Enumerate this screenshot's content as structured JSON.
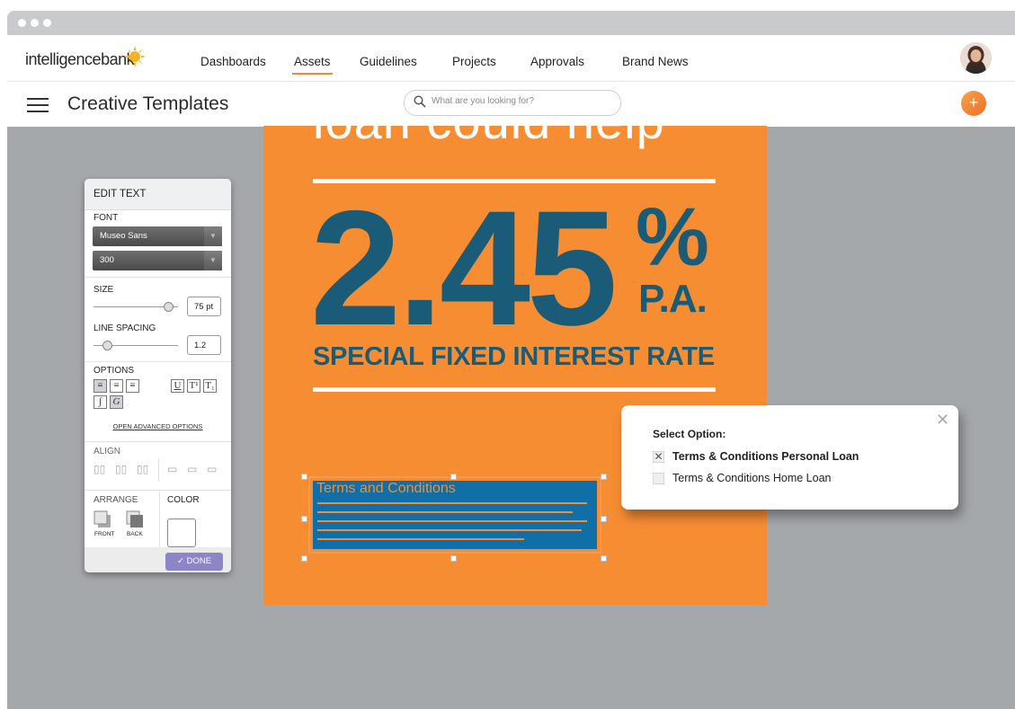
{
  "brand": {
    "name_light": "intelligence",
    "name_bold": "bank",
    "accent": "#f58a35"
  },
  "nav": {
    "items": [
      {
        "label": "Dashboards"
      },
      {
        "label": "Assets",
        "active": true
      },
      {
        "label": "Guidelines"
      },
      {
        "label": "Projects"
      },
      {
        "label": "Approvals"
      },
      {
        "label": "Brand News"
      }
    ]
  },
  "subheader": {
    "title": "Creative Templates",
    "search_placeholder": "What are you looking for?",
    "add_icon": "plus-icon"
  },
  "artwork": {
    "headline": "loan could help",
    "rate": "2.45",
    "percent": "%",
    "pa": "P.A.",
    "subline": "SPECIAL FIXED INTEREST RATE",
    "terms_label": "Terms and Conditions",
    "background": "#f68d33",
    "text_color": "#1a5c77"
  },
  "edit_panel": {
    "title": "EDIT TEXT",
    "font_label": "FONT",
    "font_family": "Museo Sans",
    "font_weight": "300",
    "size_label": "SIZE",
    "size_value": "75 pt",
    "line_spacing_label": "LINE SPACING",
    "line_spacing_value": "1.2",
    "options_label": "OPTIONS",
    "advanced_link": "OPEN ADVANCED OPTIONS",
    "align_label": "ALIGN",
    "arrange_label": "ARRANGE",
    "color_label": "COLOR",
    "front_label": "FRONT",
    "back_label": "BACK",
    "done_label": "DONE"
  },
  "select_popup": {
    "title": "Select Option:",
    "options": [
      {
        "label": "Terms & Conditions Personal Loan",
        "checked": true
      },
      {
        "label": "Terms & Conditions Home Loan",
        "checked": false
      }
    ]
  }
}
